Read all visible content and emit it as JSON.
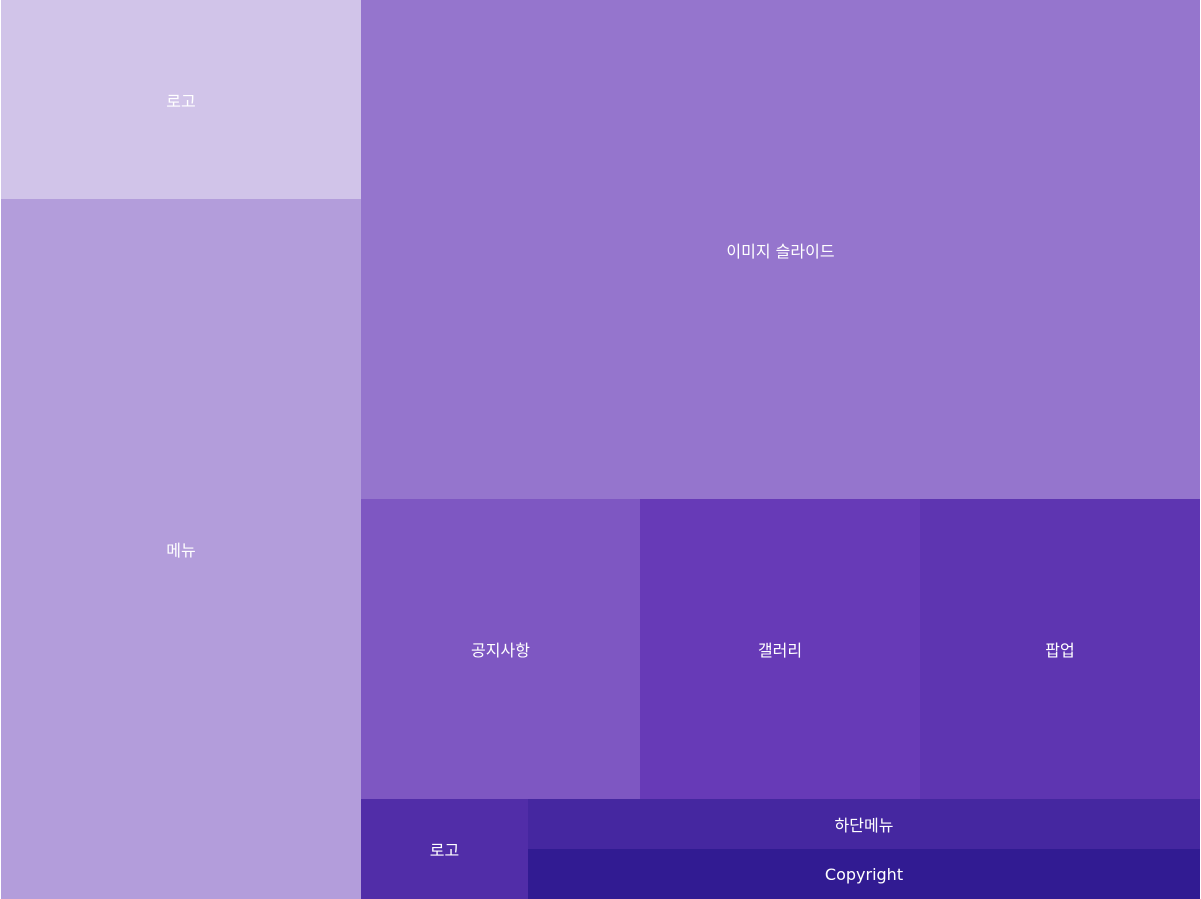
{
  "blocks": {
    "logo_top": {
      "label": "로고",
      "color": "#d1c4e9"
    },
    "menu": {
      "label": "메뉴",
      "color": "#b39ddb"
    },
    "slide": {
      "label": "이미지 슬라이드",
      "color": "#9575cd"
    },
    "notice": {
      "label": "공지사항",
      "color": "#7e57c2"
    },
    "gallery": {
      "label": "갤러리",
      "color": "#673ab7"
    },
    "popup": {
      "label": "팝업",
      "color": "#5e35b1"
    },
    "logo_footer": {
      "label": "로고",
      "color": "#512da8"
    },
    "footer_menu": {
      "label": "하단메뉴",
      "color": "#4527a0"
    },
    "copyright": {
      "label": "Copyright",
      "color": "#311b92"
    }
  }
}
